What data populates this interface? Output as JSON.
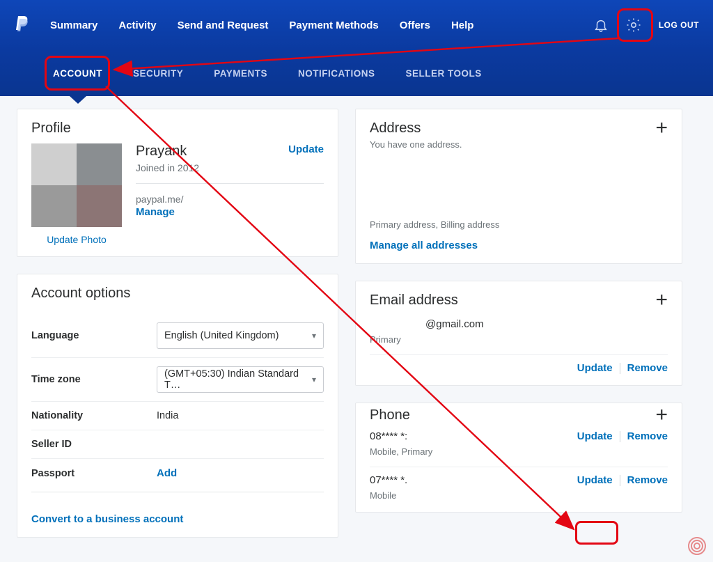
{
  "topnav": {
    "links": [
      "Summary",
      "Activity",
      "Send and Request",
      "Payment Methods",
      "Offers",
      "Help"
    ],
    "logout": "LOG OUT"
  },
  "subnav": {
    "items": [
      "ACCOUNT",
      "SECURITY",
      "PAYMENTS",
      "NOTIFICATIONS",
      "SELLER TOOLS"
    ],
    "active_index": 0
  },
  "profile": {
    "title": "Profile",
    "name": "Prayank",
    "joined": "Joined in 2012",
    "update": "Update",
    "paypalme_label": "paypal.me/",
    "manage": "Manage",
    "update_photo": "Update Photo"
  },
  "options": {
    "title": "Account options",
    "language_label": "Language",
    "language_value": "English (United Kingdom)",
    "timezone_label": "Time zone",
    "timezone_value": "(GMT+05:30) Indian Standard T…",
    "nationality_label": "Nationality",
    "nationality_value": "India",
    "sellerid_label": "Seller ID",
    "sellerid_value": "",
    "passport_label": "Passport",
    "passport_add": "Add",
    "convert": "Convert to a business account"
  },
  "address": {
    "title": "Address",
    "subtitle": "You have one address.",
    "primary_note": "Primary address, Billing address",
    "manage_all": "Manage all addresses"
  },
  "email": {
    "title": "Email address",
    "value": "@gmail.com",
    "primary": "Primary",
    "update": "Update",
    "remove": "Remove"
  },
  "phone": {
    "title": "Phone",
    "items": [
      {
        "number": "08**** *:",
        "type": "Mobile, Primary",
        "update": "Update",
        "remove": "Remove"
      },
      {
        "number": "07**** *.",
        "type": "Mobile",
        "update": "Update",
        "remove": "Remove"
      }
    ]
  }
}
